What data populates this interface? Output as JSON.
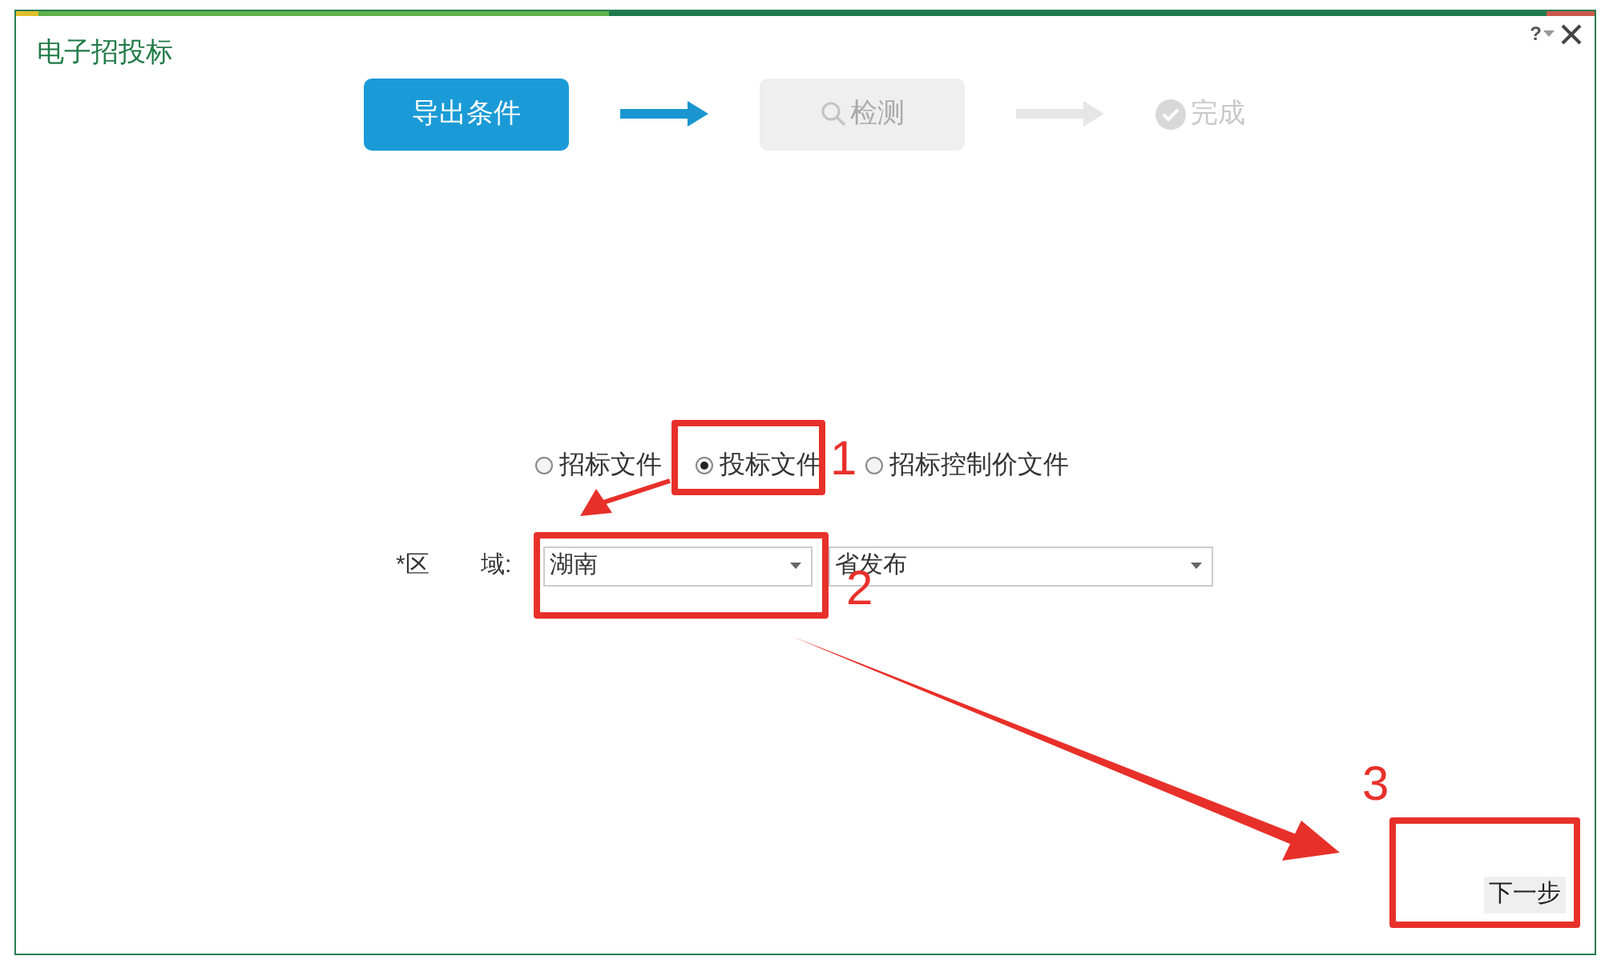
{
  "window": {
    "title": "电子招投标",
    "help": "?"
  },
  "steps": [
    {
      "label": "导出条件",
      "kind": "plain",
      "active": true
    },
    {
      "label": "检测",
      "kind": "search",
      "active": false
    },
    {
      "label": "完成",
      "kind": "done",
      "active": false
    }
  ],
  "document_types": [
    {
      "label": "招标文件",
      "selected": false
    },
    {
      "label": "投标文件",
      "selected": true
    },
    {
      "label": "招标控制价文件",
      "selected": false
    }
  ],
  "region": {
    "label_start": "*区",
    "label_end": "域:",
    "province": "湖南",
    "scope": "省发布"
  },
  "next_button": "下一步",
  "annotations": [
    {
      "number": "1"
    },
    {
      "number": "2"
    },
    {
      "number": "3"
    }
  ]
}
